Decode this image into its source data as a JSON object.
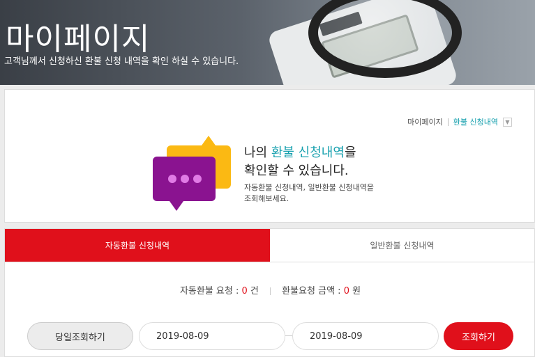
{
  "banner": {
    "title": "마이페이지",
    "subtitle": "고객님께서 신청하신 환불 신청 내역을 확인 하실 수 있습니다."
  },
  "breadcrumb": {
    "home": "마이페이지",
    "current": "환불 신청내역",
    "dropdown_icon": "chevron-down-icon"
  },
  "intro": {
    "title_prefix": "나의 ",
    "title_highlight": "환불 신청내역",
    "title_suffix": "을",
    "title_line2": "확인할 수 있습니다.",
    "desc_line1": "자동환불 신청내역, 일반환불 신청내역을",
    "desc_line2": "조회해보세요.",
    "accent_color": "#16a0ae"
  },
  "tabs": [
    {
      "label": "자동환불 신청내역",
      "active": true
    },
    {
      "label": "일반환불 신청내역",
      "active": false
    }
  ],
  "summary": {
    "request_label": "자동환불 요청 : ",
    "request_count": "0",
    "request_unit": " 건",
    "amount_label": "환불요청 금액 : ",
    "amount_value": "0",
    "amount_unit": " 원"
  },
  "search": {
    "today_button": "당일조회하기",
    "start_date": "2019-08-09",
    "end_date": "2019-08-09",
    "search_button": "조회하기"
  },
  "colors": {
    "brand_red": "#e0101b",
    "highlight_teal": "#16a0ae"
  }
}
